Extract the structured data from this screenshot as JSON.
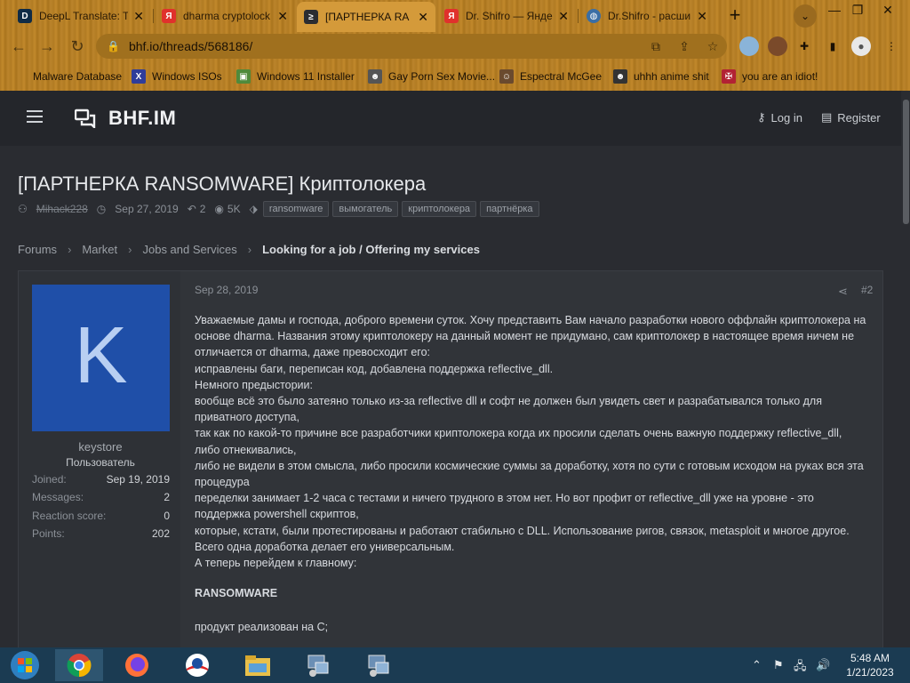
{
  "browser": {
    "tabs": [
      {
        "title": "DeepL Translate: T",
        "icon": "deepl-icon",
        "color": "#0f2b46"
      },
      {
        "title": "dharma cryptolock",
        "icon": "yandex-icon",
        "color": "#e0312c"
      },
      {
        "title": "[ПАРТНЕРКА RA",
        "icon": "bhf-icon",
        "color": "#333",
        "active": true
      },
      {
        "title": "Dr. Shifro — Янде",
        "icon": "yandex-icon",
        "color": "#e0312c"
      },
      {
        "title": "Dr.Shifro - расши",
        "icon": "globe-icon",
        "color": "#3a6ea5"
      }
    ],
    "url": "bhf.io/threads/568186/",
    "bookmarks": [
      {
        "label": "Malware Database",
        "icon": "folder-icon",
        "color": "#e2b24a"
      },
      {
        "label": "Windows ISOs",
        "icon": "x-icon",
        "color": "#2f3d9a"
      },
      {
        "label": "Windows 11 Installer",
        "icon": "image-icon",
        "color": "#4f8a3b"
      },
      {
        "label": "Gay Porn Sex Movie...",
        "icon": "mascot-icon",
        "color": "#555"
      },
      {
        "label": "Espectral McGee",
        "icon": "face-icon",
        "color": "#6a4a2e"
      },
      {
        "label": "uhhh anime shit",
        "icon": "anime-icon",
        "color": "#333"
      },
      {
        "label": "you are an idiot!",
        "icon": "flag-icon",
        "color": "#b22234"
      }
    ]
  },
  "site": {
    "logo_text": "BHF.IM",
    "login_label": "Log in",
    "register_label": "Register"
  },
  "thread": {
    "title": "[ПАРТНЕРКА RANSOMWARE] Криптолокера",
    "author": "Mihack228",
    "date": "Sep 27, 2019",
    "replies": "2",
    "views": "5K",
    "tags": [
      "ransomware",
      "вымогатель",
      "криптолокера",
      "партнёрка"
    ]
  },
  "breadcrumb": [
    "Forums",
    "Market",
    "Jobs and Services",
    "Looking for a job / Offering my services"
  ],
  "post": {
    "date": "Sep 28, 2019",
    "number": "#2",
    "user": {
      "avatar_letter": "K",
      "name": "keystore",
      "title": "Пользователь",
      "stats": [
        {
          "key": "Joined:",
          "value": "Sep 19, 2019"
        },
        {
          "key": "Messages:",
          "value": "2"
        },
        {
          "key": "Reaction score:",
          "value": "0"
        },
        {
          "key": "Points:",
          "value": "202"
        }
      ]
    },
    "body": [
      "Уважаемые дамы и господа, доброго времени суток. Хочу представить Вам начало разработки нового оффлайн криптолокера на основе dharma. Названия этому криптолокеру на данный момент не придумано, сам криптолокер в настоящее время ничем не отличается от dharma, даже превосходит его:",
      "исправлены баги, переписан код, добавлена поддержка reflective_dll.",
      "Немного предыстории:",
      "вообще всё это было затеяно только из-за reflective dll и софт не должен был увидеть свет и разрабатывался только для приватного доступа,",
      "так как по какой-то причине все разработчики криптолокера когда их просили сделать очень важную поддержку reflective_dll, либо отнекивались,",
      "либо не видели в этом смысла, либо просили космические суммы за доработку, хотя по сути с готовым исходом на руках вся эта процедура",
      "переделки занимает 1-2 часа с тестами и ничего трудного в этом нет. Но вот профит от reflective_dll уже на уровне - это поддержка powershell скриптов,",
      "которые, кстати, были протестированы и работают стабильно с DLL. Использование ригов, связок, metasploit и многое другое.",
      "Всего одна доработка делает его универсальным.",
      "А теперь перейдем к главному:"
    ],
    "heading": "RANSOMWARE",
    "after_heading": "продукт реализован на С;"
  },
  "taskbar": {
    "time": "5:48 AM",
    "date": "1/21/2023"
  }
}
